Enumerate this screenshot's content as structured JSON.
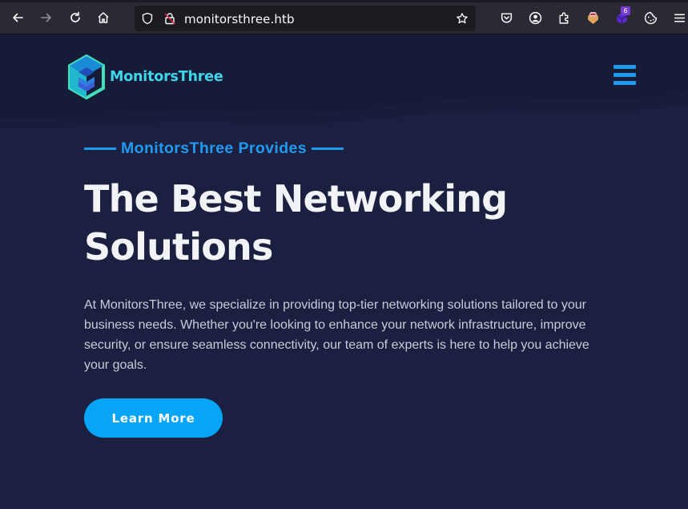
{
  "browser": {
    "url": "monitorsthree.htb",
    "extension_badge": "6"
  },
  "site": {
    "brand": "MonitorsThree",
    "brand_color": "#3fd6ea",
    "accent_color": "#1e9bf0",
    "button_color": "#07a5f7",
    "background_color": "#1b2041"
  },
  "hero": {
    "eyebrow": "MonitorsThree Provides",
    "headline": "The Best Networking Solutions",
    "intro": "At MonitorsThree, we specialize in providing top-tier networking solutions tailored to your business needs. Whether you're looking to enhance your network infrastructure, improve security, or ensure seamless connectivity, our team of experts is here to help you achieve your goals.",
    "cta_label": "Learn More"
  },
  "icons": {
    "back": "back-arrow-icon",
    "forward": "forward-arrow-icon",
    "reload": "reload-icon",
    "home": "home-icon",
    "shield": "tracking-shield-icon",
    "insecure": "insecure-lock-icon",
    "bookmark": "star-icon",
    "pocket": "pocket-icon",
    "account": "account-icon",
    "extensions": "puzzle-icon",
    "menu": "hamburger-icon"
  }
}
